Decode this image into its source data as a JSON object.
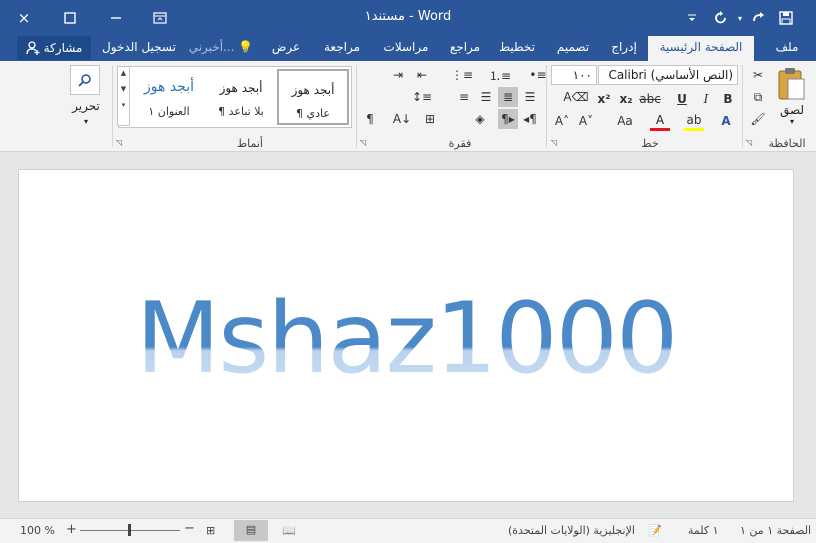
{
  "titlebar": {
    "title": "مستند١ - Word",
    "close_icon": "×",
    "restore_icon": "☐",
    "save_icon": "💾"
  },
  "tabs": {
    "file": "ملف",
    "home": "الصفحة الرئيسية",
    "insert": "إدراج",
    "design": "تصميم",
    "layout": "تخطيط",
    "references": "مراجع",
    "mailings": "مراسلات",
    "review": "مراجعة",
    "view": "عرض",
    "tellme": "أخبرني...",
    "signin": "تسجيل الدخول",
    "share": "مشاركة"
  },
  "ribbon": {
    "clipboard": {
      "label": "الحافظة",
      "paste": "لصق"
    },
    "font": {
      "label": "خط",
      "font_name": "(النص الأساسي) Calibri",
      "font_size": "١٠٠"
    },
    "paragraph": {
      "label": "فقرة"
    },
    "styles": {
      "label": "أنماط",
      "items": [
        {
          "sample": "أبجد هوز",
          "name": "¶ عادي"
        },
        {
          "sample": "أبجد هوز",
          "name": "¶ بلا تباعد"
        },
        {
          "sample": "أبجد هوز",
          "name": "العنوان ١"
        }
      ]
    },
    "editing": {
      "label": "تحرير"
    }
  },
  "document": {
    "text": "Mshaz1000"
  },
  "status": {
    "page": "الصفحة ١ من ١",
    "words": "١ كلمة",
    "language": "الإنجليزية (الولايات المتحدة)",
    "zoom": "100 %"
  },
  "colors": {
    "brand": "#2b579a",
    "heading": "#2e74b5",
    "font_color": "#e81123",
    "highlight": "#ffff00"
  }
}
